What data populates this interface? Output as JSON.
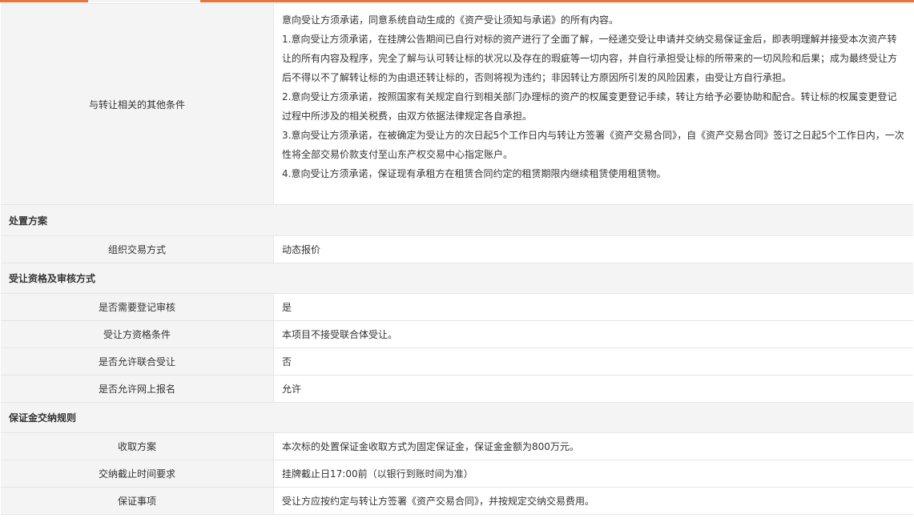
{
  "conditions": {
    "label": "与转让相关的其他条件",
    "paragraphs": [
      "意向受让方须承诺，同意系统自动生成的《资产受让须知与承诺》的所有内容。",
      "1.意向受让方须承诺，在挂牌公告期间已自行对标的资产进行了全面了解，一经递交受让申请并交纳交易保证金后，即表明理解并接受本次资产转让的所有内容及程序，完全了解与认可转让标的状况以及存在的瑕疵等一切内容，并自行承担受让标的所带来的一切风险和后果；成为最终受让方后不得以不了解转让标的为由退还转让标的，否则将视为违约；非因转让方原因所引发的风险因素，由受让方自行承担。",
      "2.意向受让方须承诺，按照国家有关规定自行到相关部门办理标的资产的权属变更登记手续，转让方给予必要协助和配合。转让标的权属变更登记过程中所涉及的相关税费，由双方依据法律规定各自承担。",
      "3.意向受让方须承诺，在被确定为受让方的次日起5个工作日内与转让方签署《资产交易合同》，自《资产交易合同》签订之日起5个工作日内，一次性将全部交易价款支付至山东产权交易中心指定账户。",
      "4.意向受让方须承诺，保证现有承租方在租赁合同约定的租赁期限内继续租赁使用租赁物。"
    ]
  },
  "disposal": {
    "title": "处置方案",
    "method_label": "组织交易方式",
    "method_value": "动态报价"
  },
  "qualification": {
    "title": "受让资格及审核方式",
    "rows": [
      {
        "label": "是否需要登记审核",
        "value": "是"
      },
      {
        "label": "受让方资格条件",
        "value": "本项目不接受联合体受让。"
      },
      {
        "label": "是否允许联合受让",
        "value": "否"
      },
      {
        "label": "是否允许网上报名",
        "value": "允许"
      }
    ]
  },
  "deposit": {
    "title": "保证金交纳规则",
    "rows": [
      {
        "label": "收取方案",
        "value": "本次标的处置保证金收取方式为固定保证金，保证金金额为800万元。"
      },
      {
        "label": "交纳截止时间要求",
        "value": "挂牌截止日17:00前（以银行到账时间为准）"
      },
      {
        "label": "保证事项",
        "value": "受让方应按约定与转让方签署《资产交易合同》，并按规定交纳交易费用。"
      }
    ]
  }
}
